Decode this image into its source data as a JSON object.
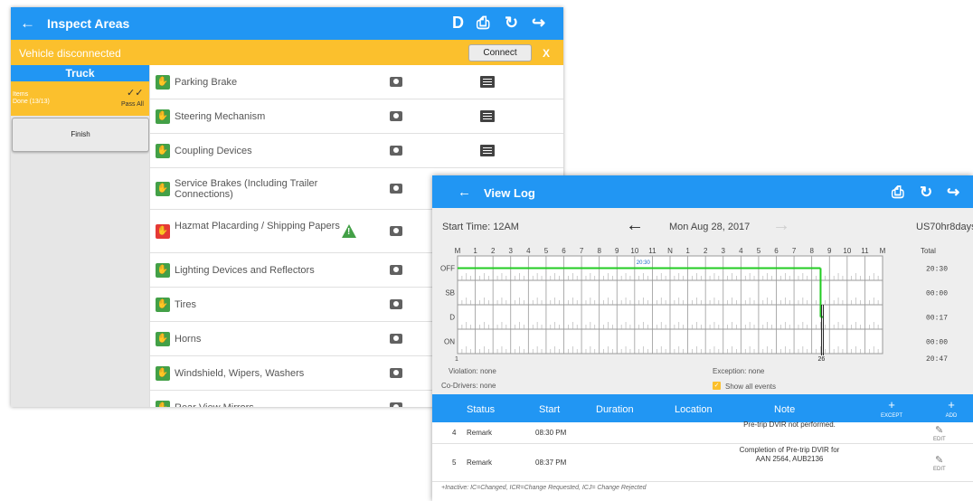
{
  "inspect": {
    "title": "Inspect Areas",
    "toolbar": {
      "d_label": "D"
    },
    "banner": {
      "message": "Vehicle disconnected",
      "connect_label": "Connect",
      "close_label": "X"
    },
    "sidebar": {
      "header": "Truck",
      "items_label": "Items",
      "items_count": "Done (13/13)",
      "pass_all_label": "Pass All",
      "finish_label": "Finish"
    },
    "areas": [
      {
        "label": "Parking Brake",
        "status": "ok",
        "has_note": true
      },
      {
        "label": "Steering Mechanism",
        "status": "ok",
        "has_note": true
      },
      {
        "label": "Coupling Devices",
        "status": "ok",
        "has_note": true
      },
      {
        "label": "Service Brakes (Including Trailer Connections)",
        "status": "ok",
        "has_note": false
      },
      {
        "label": "Hazmat Placarding / Shipping Papers",
        "status": "defect",
        "has_note": false,
        "warning": true
      },
      {
        "label": "Lighting Devices and Reflectors",
        "status": "ok",
        "has_note": false
      },
      {
        "label": "Tires",
        "status": "ok",
        "has_note": false
      },
      {
        "label": "Horns",
        "status": "ok",
        "has_note": false
      },
      {
        "label": "Windshield, Wipers, Washers",
        "status": "ok",
        "has_note": false
      },
      {
        "label": "Rear View Mirrors",
        "status": "ok",
        "has_note": false
      }
    ]
  },
  "viewlog": {
    "title": "View Log",
    "start_time": "Start Time: 12AM",
    "date": "Mon Aug 28, 2017",
    "rule": "US70hr8days",
    "graph": {
      "hour_labels": [
        "M",
        "1",
        "2",
        "3",
        "4",
        "5",
        "6",
        "7",
        "8",
        "9",
        "10",
        "11",
        "N",
        "1",
        "2",
        "3",
        "4",
        "5",
        "6",
        "7",
        "8",
        "9",
        "10",
        "11",
        "M"
      ],
      "row_labels": [
        "OFF",
        "SB",
        "D",
        "ON"
      ],
      "totals_header": "Total",
      "totals": [
        "20:30",
        "00:00",
        "00:17",
        "00:00",
        "20:47"
      ],
      "marker_label": "20:30",
      "bottom_left": "1",
      "bottom_mark": "26"
    },
    "info": {
      "violation": "Violation: none",
      "codrivers": "Co-Drivers: none",
      "exception": "Exception: none",
      "show_all": "Show all events"
    },
    "table": {
      "headers": [
        "Status",
        "Start",
        "Duration",
        "Location",
        "Note"
      ],
      "except_label": "EXCEPT",
      "add_label": "ADD",
      "edit_label": "EDIT",
      "rows": [
        {
          "num": "4",
          "status": "Remark",
          "start": "08:30 PM",
          "note": "Pre-trip DVIR not performed."
        },
        {
          "num": "5",
          "status": "Remark",
          "start": "08:37 PM",
          "note": "Completion of Pre-trip DVIR for AAN 2564, AUB2136"
        }
      ]
    },
    "legend": "+Inactive: IC=Changed, ICR=Change Requested, ICJ= Change Rejected"
  },
  "colors": {
    "primary": "#2196f3",
    "warning_bar": "#fbc02d",
    "ok": "#43a047",
    "defect": "#e53935",
    "graph_line": "#22cc22"
  }
}
